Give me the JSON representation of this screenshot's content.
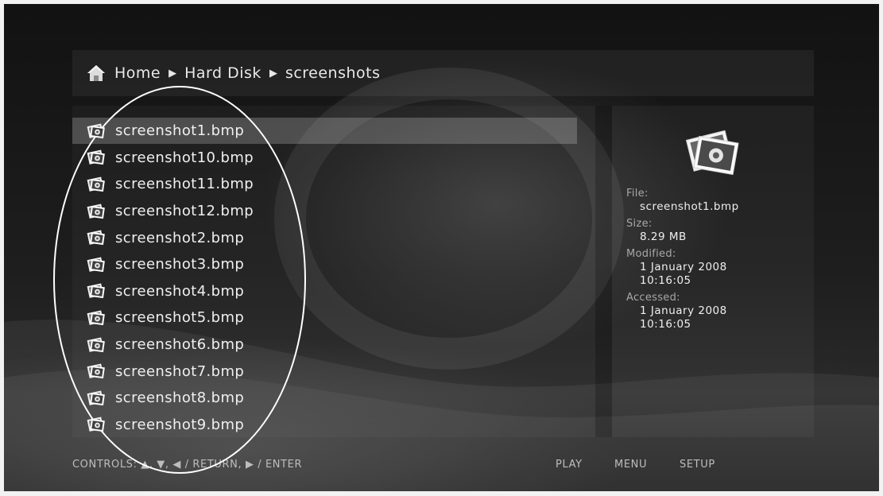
{
  "breadcrumb": {
    "items": [
      "Home",
      "Hard Disk",
      "screenshots"
    ],
    "separator": "▶"
  },
  "files": [
    {
      "name": "screenshot1.bmp",
      "selected": true
    },
    {
      "name": "screenshot10.bmp"
    },
    {
      "name": "screenshot11.bmp"
    },
    {
      "name": "screenshot12.bmp"
    },
    {
      "name": "screenshot2.bmp"
    },
    {
      "name": "screenshot3.bmp"
    },
    {
      "name": "screenshot4.bmp"
    },
    {
      "name": "screenshot5.bmp"
    },
    {
      "name": "screenshot6.bmp"
    },
    {
      "name": "screenshot7.bmp"
    },
    {
      "name": "screenshot8.bmp"
    },
    {
      "name": "screenshot9.bmp"
    }
  ],
  "details": {
    "file_label": "File:",
    "file_value": "screenshot1.bmp",
    "size_label": "Size:",
    "size_value": "8.29 MB",
    "modified_label": "Modified:",
    "modified_date": "1 January 2008",
    "modified_time": "10:16:05",
    "accessed_label": "Accessed:",
    "accessed_date": "1 January 2008",
    "accessed_time": "10:16:05"
  },
  "footer": {
    "controls": "CONTROLS:  ▲, ▼, ◀ / RETURN,  ▶ / ENTER",
    "play": "PLAY",
    "menu": "MENU",
    "setup": "SETUP"
  },
  "icons": {
    "home": "home-icon",
    "file": "image-file-icon",
    "preview": "photo-preview-icon"
  },
  "colors": {
    "background": "#1c1c1c",
    "text": "#efefef",
    "label": "#a8a8a8",
    "selection": "#5a5a5a"
  }
}
